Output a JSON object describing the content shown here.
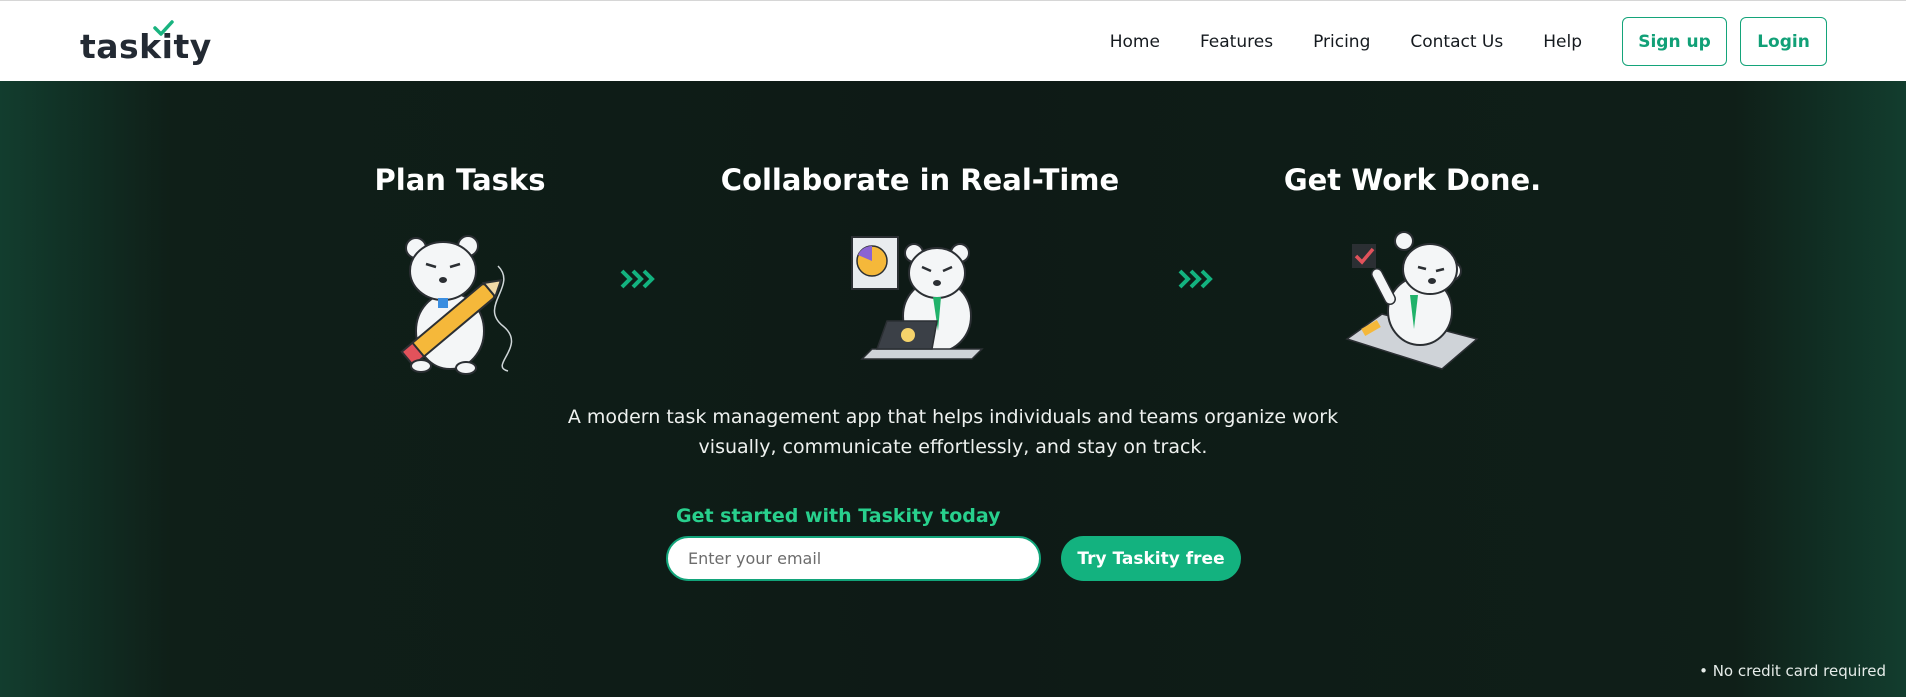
{
  "header": {
    "logo_text": "taskity",
    "nav": [
      "Home",
      "Features",
      "Pricing",
      "Contact Us",
      "Help"
    ],
    "signup_label": "Sign up",
    "login_label": "Login"
  },
  "hero": {
    "steps": [
      {
        "title": "Plan Tasks"
      },
      {
        "title": "Collaborate in Real-Time"
      },
      {
        "title": "Get Work Done."
      }
    ],
    "tagline_line1": "A modern task management app that helps individuals and teams organize work",
    "tagline_line2": "visually, communicate effortlessly, and stay on track.",
    "cta_label": "Get started with Taskity today",
    "email_placeholder": "Enter your email",
    "try_label": "Try Taskity free",
    "no_card": "• No credit card required"
  },
  "colors": {
    "brand_green": "#13b27f",
    "hero_bg": "#0e1a16",
    "header_bg": "#ffffff",
    "text_dark": "#151a1f"
  }
}
